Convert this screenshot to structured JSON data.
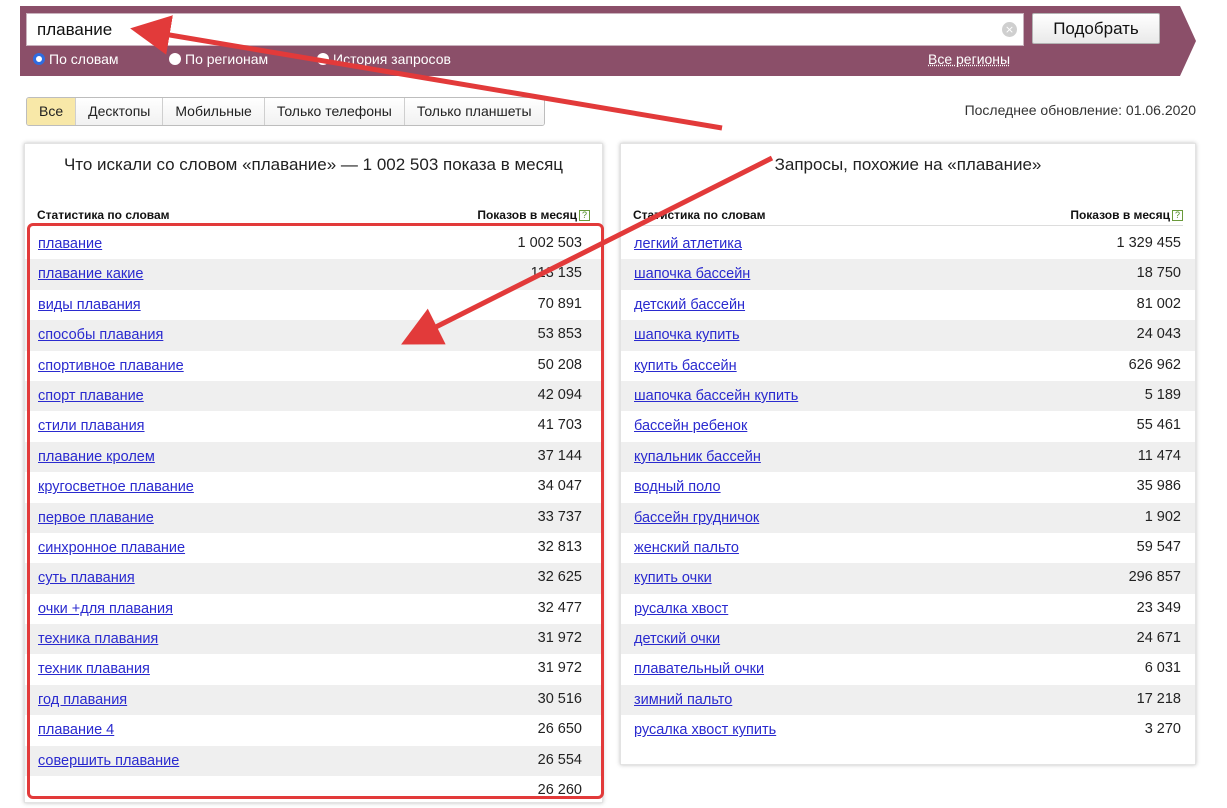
{
  "search": {
    "query": "плавание",
    "clear_icon": "×",
    "submit_label": "Подобрать",
    "modes": [
      {
        "label": "По словам",
        "selected": true
      },
      {
        "label": "По регионам",
        "selected": false
      },
      {
        "label": "История запросов",
        "selected": false
      }
    ],
    "regions_link": "Все регионы"
  },
  "filters": {
    "tabs": [
      {
        "label": "Все",
        "active": true
      },
      {
        "label": "Десктопы",
        "active": false
      },
      {
        "label": "Мобильные",
        "active": false
      },
      {
        "label": "Только телефоны",
        "active": false
      },
      {
        "label": "Только планшеты",
        "active": false
      }
    ],
    "last_update": "Последнее обновление: 01.06.2020"
  },
  "left_panel": {
    "title": "Что искали со словом «плавание» — 1 002 503 показа в месяц",
    "col_keyword": "Статистика по словам",
    "col_count": "Показов в месяц",
    "help": "?",
    "rows": [
      {
        "kw": "плавание",
        "cnt": "1 002 503"
      },
      {
        "kw": "плавание какие",
        "cnt": "113 135"
      },
      {
        "kw": "виды плавания",
        "cnt": "70 891"
      },
      {
        "kw": "способы плавания",
        "cnt": "53 853"
      },
      {
        "kw": "спортивное плавание",
        "cnt": "50 208"
      },
      {
        "kw": "спорт плавание",
        "cnt": "42 094"
      },
      {
        "kw": "стили плавания",
        "cnt": "41 703"
      },
      {
        "kw": "плавание кролем",
        "cnt": "37 144"
      },
      {
        "kw": "кругосветное плавание",
        "cnt": "34 047"
      },
      {
        "kw": "первое плавание",
        "cnt": "33 737"
      },
      {
        "kw": "синхронное плавание",
        "cnt": "32 813"
      },
      {
        "kw": "суть плавания",
        "cnt": "32 625"
      },
      {
        "kw": "очки +для плавания",
        "cnt": "32 477"
      },
      {
        "kw": "техника плавания",
        "cnt": "31 972"
      },
      {
        "kw": "техник плавания",
        "cnt": "31 972"
      },
      {
        "kw": "год плавания",
        "cnt": "30 516"
      },
      {
        "kw": "плавание 4",
        "cnt": "26 650"
      },
      {
        "kw": "совершить плавание",
        "cnt": "26 554"
      },
      {
        "kw": "",
        "cnt": "26 260"
      }
    ]
  },
  "right_panel": {
    "title": "Запросы, похожие на «плавание»",
    "col_keyword": "Статистика по словам",
    "col_count": "Показов в месяц",
    "help": "?",
    "rows": [
      {
        "kw": "легкий атлетика",
        "cnt": "1 329 455"
      },
      {
        "kw": "шапочка бассейн",
        "cnt": "18 750"
      },
      {
        "kw": "детский бассейн",
        "cnt": "81 002"
      },
      {
        "kw": "шапочка купить",
        "cnt": "24 043"
      },
      {
        "kw": "купить бассейн",
        "cnt": "626 962"
      },
      {
        "kw": "шапочка бассейн купить",
        "cnt": "5 189"
      },
      {
        "kw": "бассейн ребенок",
        "cnt": "55 461"
      },
      {
        "kw": "купальник бассейн",
        "cnt": "11 474"
      },
      {
        "kw": "водный поло",
        "cnt": "35 986"
      },
      {
        "kw": "бассейн грудничок",
        "cnt": "1 902"
      },
      {
        "kw": "женский пальто",
        "cnt": "59 547"
      },
      {
        "kw": "купить очки",
        "cnt": "296 857"
      },
      {
        "kw": "русалка хвост",
        "cnt": "23 349"
      },
      {
        "kw": "детский очки",
        "cnt": "24 671"
      },
      {
        "kw": "плавательный очки",
        "cnt": "6 031"
      },
      {
        "kw": "зимний пальто",
        "cnt": "17 218"
      },
      {
        "kw": "русалка хвост купить",
        "cnt": "3 270"
      }
    ]
  },
  "colors": {
    "header_bg": "#8b4f69",
    "link": "#2a2acf",
    "annotation": "#e23a3a",
    "active_tab": "#f8e8a8"
  }
}
